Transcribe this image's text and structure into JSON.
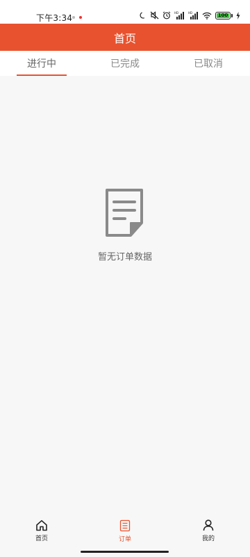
{
  "status_bar": {
    "time": "下午3:34",
    "battery": "100"
  },
  "header": {
    "title": "首页"
  },
  "tabs": [
    {
      "label": "进行中",
      "active": true
    },
    {
      "label": "已完成",
      "active": false
    },
    {
      "label": "已取消",
      "active": false
    }
  ],
  "empty_state": {
    "icon": "document-icon",
    "message": "暂无订单数据"
  },
  "bottom_nav": {
    "items": [
      {
        "label": "首页",
        "icon": "home-icon",
        "active": false
      },
      {
        "label": "订单",
        "icon": "order-icon",
        "active": true
      },
      {
        "label": "我的",
        "icon": "user-icon",
        "active": false
      }
    ]
  },
  "colors": {
    "accent": "#e8522e",
    "background": "#f7f7f7"
  }
}
